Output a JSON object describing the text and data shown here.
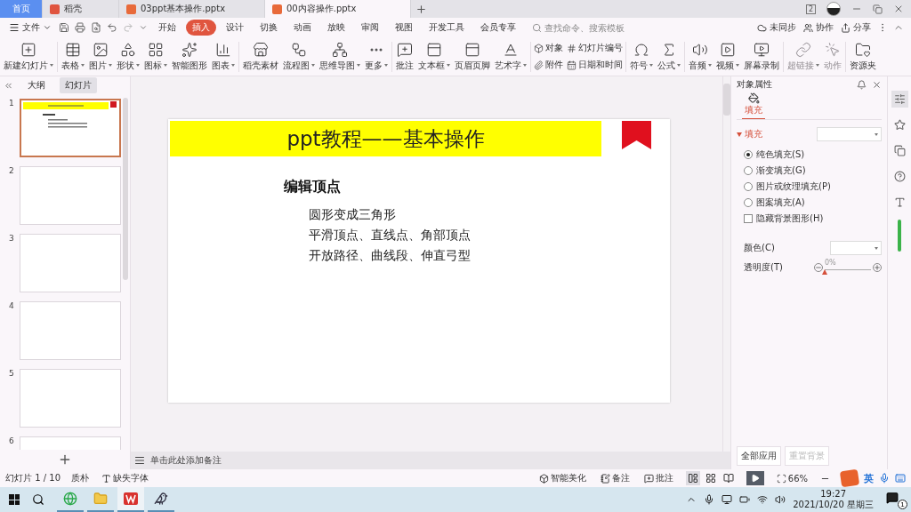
{
  "tabs": [
    {
      "label": "首页",
      "kind": "home",
      "selected": false
    },
    {
      "label": "稻壳",
      "kind": "docer",
      "selected": false
    },
    {
      "label": "03ppt基本操作.pptx",
      "kind": "file",
      "selected": false
    },
    {
      "label": "00内容操作.pptx",
      "kind": "file",
      "selected": true
    }
  ],
  "window_badge": "2",
  "menu": {
    "file": "文件",
    "items": [
      {
        "label": "开始",
        "selected": false
      },
      {
        "label": "插入",
        "selected": true
      },
      {
        "label": "设计",
        "selected": false
      },
      {
        "label": "切换",
        "selected": false
      },
      {
        "label": "动画",
        "selected": false
      },
      {
        "label": "放映",
        "selected": false
      },
      {
        "label": "审阅",
        "selected": false
      },
      {
        "label": "视图",
        "selected": false
      },
      {
        "label": "开发工具",
        "selected": false
      },
      {
        "label": "会员专享",
        "selected": false
      }
    ],
    "search": {
      "placeholder": "查找命令、搜索模板"
    },
    "actions": [
      "未同步",
      "协作",
      "分享"
    ]
  },
  "ribbon": {
    "tools": [
      {
        "label": "新建幻灯片",
        "caret": true,
        "disabled": false
      },
      {
        "label": "表格",
        "caret": true,
        "disabled": false
      },
      {
        "label": "图片",
        "caret": true,
        "disabled": false
      },
      {
        "label": "形状",
        "caret": true,
        "disabled": false
      },
      {
        "label": "图标",
        "caret": true,
        "disabled": false
      },
      {
        "label": "智能图形",
        "caret": false,
        "disabled": false
      },
      {
        "label": "图表",
        "caret": true,
        "disabled": false
      },
      {
        "label": "稻壳素材",
        "caret": false,
        "disabled": false
      },
      {
        "label": "流程图",
        "caret": true,
        "disabled": false
      },
      {
        "label": "思维导图",
        "caret": true,
        "disabled": false
      },
      {
        "label": "更多",
        "caret": true,
        "disabled": false
      },
      {
        "label": "批注",
        "caret": false,
        "disabled": false
      },
      {
        "label": "文本框",
        "caret": true,
        "disabled": false
      },
      {
        "label": "页眉页脚",
        "caret": false,
        "disabled": false
      },
      {
        "label": "艺术字",
        "caret": true,
        "disabled": false
      }
    ],
    "grid": [
      "对象",
      "幻灯片编号",
      "附件",
      "日期和时间"
    ],
    "more_tools": [
      {
        "label": "符号",
        "caret": true,
        "disabled": false
      },
      {
        "label": "公式",
        "caret": true,
        "disabled": false
      },
      {
        "label": "音频",
        "caret": true,
        "disabled": false
      },
      {
        "label": "视频",
        "caret": true,
        "disabled": false
      },
      {
        "label": "屏幕录制",
        "caret": false,
        "disabled": false
      },
      {
        "label": "超链接",
        "caret": true,
        "disabled": true
      },
      {
        "label": "动作",
        "caret": false,
        "disabled": true
      },
      {
        "label": "资源夹",
        "caret": false,
        "disabled": false
      }
    ]
  },
  "outline": {
    "tabs": [
      {
        "label": "大纲",
        "selected": false
      },
      {
        "label": "幻灯片",
        "selected": true
      }
    ],
    "slides": [
      {
        "number": "1",
        "selected": true,
        "kind": "content"
      },
      {
        "number": "2",
        "selected": false,
        "kind": "blank"
      },
      {
        "number": "3",
        "selected": false,
        "kind": "blank"
      },
      {
        "number": "4",
        "selected": false,
        "kind": "blank"
      },
      {
        "number": "5",
        "selected": false,
        "kind": "blank"
      },
      {
        "number": "6",
        "selected": false,
        "kind": "blank"
      }
    ]
  },
  "slide": {
    "title": "ppt教程——基本操作",
    "heading": "编辑顶点",
    "bullets": [
      "圆形变成三角形",
      "平滑顶点、直线点、角部顶点",
      "开放路径、曲线段、伸直弓型"
    ]
  },
  "notes": {
    "placeholder": "单击此处添加备注"
  },
  "properties": {
    "title": "对象属性",
    "tab": {
      "label": "填充",
      "selected": true
    },
    "section": {
      "label": "填充",
      "expanded": true
    },
    "options": [
      {
        "kind": "radio",
        "label": "纯色填充(S)",
        "checked": true
      },
      {
        "kind": "radio",
        "label": "渐变填充(G)",
        "checked": false
      },
      {
        "kind": "radio",
        "label": "图片或纹理填充(P)",
        "checked": false
      },
      {
        "kind": "radio",
        "label": "图案填充(A)",
        "checked": false
      },
      {
        "kind": "checkbox",
        "label": "隐藏背景图形(H)",
        "checked": false
      }
    ],
    "color_label": "颜色(C)",
    "transparency_label": "透明度(T)",
    "transparency": {
      "level": 0,
      "reading": "0%"
    },
    "buttons": [
      {
        "label": "全部应用",
        "disabled": false
      },
      {
        "label": "重置背景",
        "disabled": true
      }
    ]
  },
  "status": {
    "slide_count": "幻灯片 1 / 10",
    "theme": "质朴",
    "missing_font": "缺失字体",
    "beautify": "智能美化",
    "notes": "备注",
    "comments": "批注",
    "views": [
      {
        "selected": true
      },
      {
        "selected": false
      },
      {
        "selected": false
      }
    ],
    "zoom": "66%",
    "ime": "英"
  },
  "taskbar": {
    "apps": [
      {
        "kind": "browser",
        "selected": false
      },
      {
        "kind": "folder",
        "selected": false
      },
      {
        "kind": "wps",
        "selected": true
      },
      {
        "kind": "bird",
        "selected": false
      }
    ],
    "time": "19:27",
    "date": "2021/10/20 星期三",
    "notifications": "1"
  }
}
